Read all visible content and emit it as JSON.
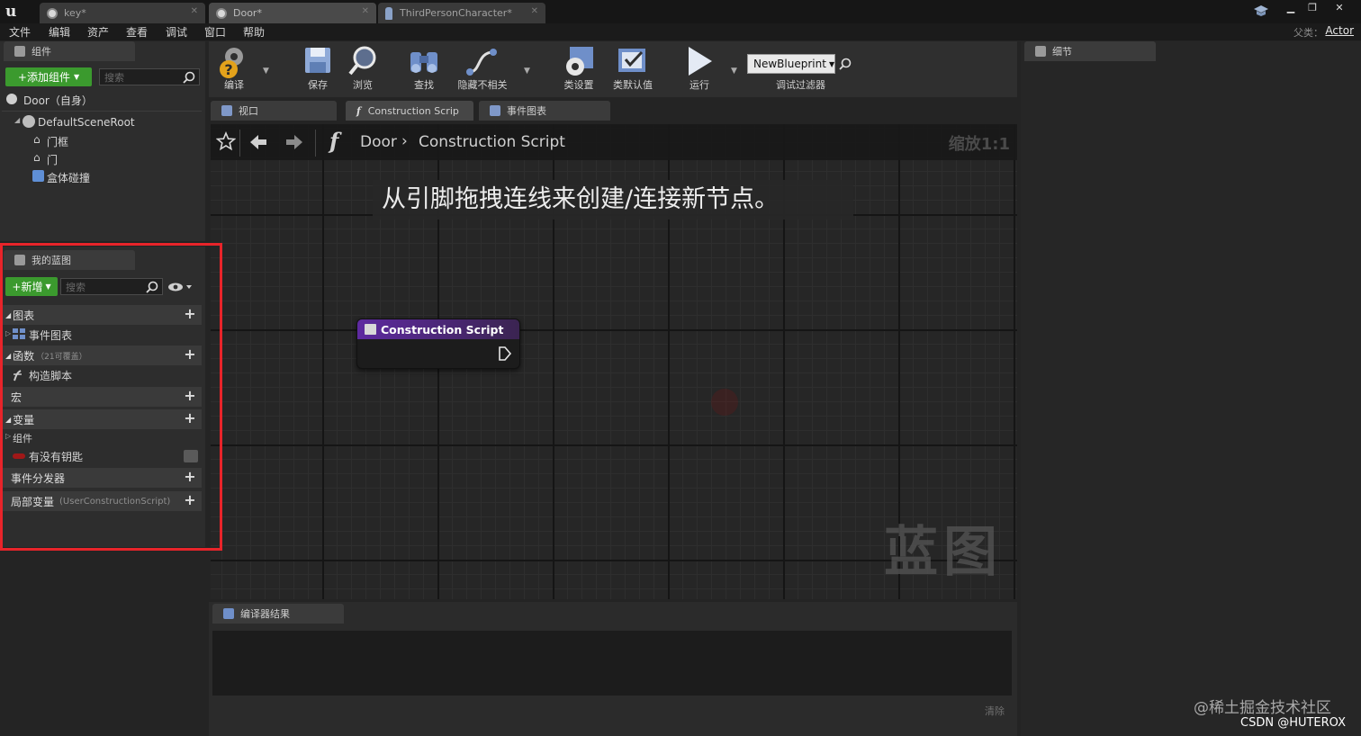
{
  "tabs": [
    {
      "label": "key*"
    },
    {
      "label": "Door*"
    },
    {
      "label": "ThirdPersonCharacter*"
    }
  ],
  "menu": [
    "文件",
    "编辑",
    "资产",
    "查看",
    "调试",
    "窗口",
    "帮助"
  ],
  "parent_class": {
    "label": "父类：",
    "value": "Actor"
  },
  "components_panel": {
    "tab": "组件",
    "add_button": "+添加组件",
    "search_placeholder": "搜索",
    "self_item": "Door（自身）",
    "root": "DefaultSceneRoot",
    "children": [
      "门框",
      "门",
      "盒体碰撞"
    ]
  },
  "my_blueprint": {
    "tab": "我的蓝图",
    "new_button": "+新增",
    "search_placeholder": "搜索",
    "graphs": "图表",
    "event_graph": "事件图表",
    "functions": "函数",
    "functions_overridable": "（21可覆盖）",
    "construction_script": "构造脚本",
    "macros": "宏",
    "variables": "变量",
    "components": "组件",
    "variable_item": "有没有钥匙",
    "event_dispatchers": "事件分发器",
    "local_variables": "局部变量",
    "local_variables_scope": "(UserConstructionScript)"
  },
  "toolbar": {
    "compile": "编译",
    "save": "保存",
    "browse": "浏览",
    "find": "查找",
    "hide_unrelated": "隐藏不相关",
    "class_settings": "类设置",
    "class_defaults": "类默认值",
    "play": "运行",
    "debug_object": "NewBlueprint",
    "debug_filter": "调试过滤器"
  },
  "editor_tabs": [
    "视口",
    "Construction Scrip",
    "事件图表"
  ],
  "graph": {
    "breadcrumb_root": "Door",
    "breadcrumb_current": "Construction Script",
    "zoom": "缩放1:1",
    "hint": "从引脚拖拽连线来创建/连接新节点。",
    "watermark": "蓝图",
    "node_title": "Construction Script"
  },
  "compiler": {
    "tab": "编译器结果",
    "clear": "清除"
  },
  "details": {
    "tab": "细节"
  },
  "watermarks": {
    "juejin": "@稀土掘金技术社区",
    "csdn": "CSDN @HUTEROX"
  }
}
